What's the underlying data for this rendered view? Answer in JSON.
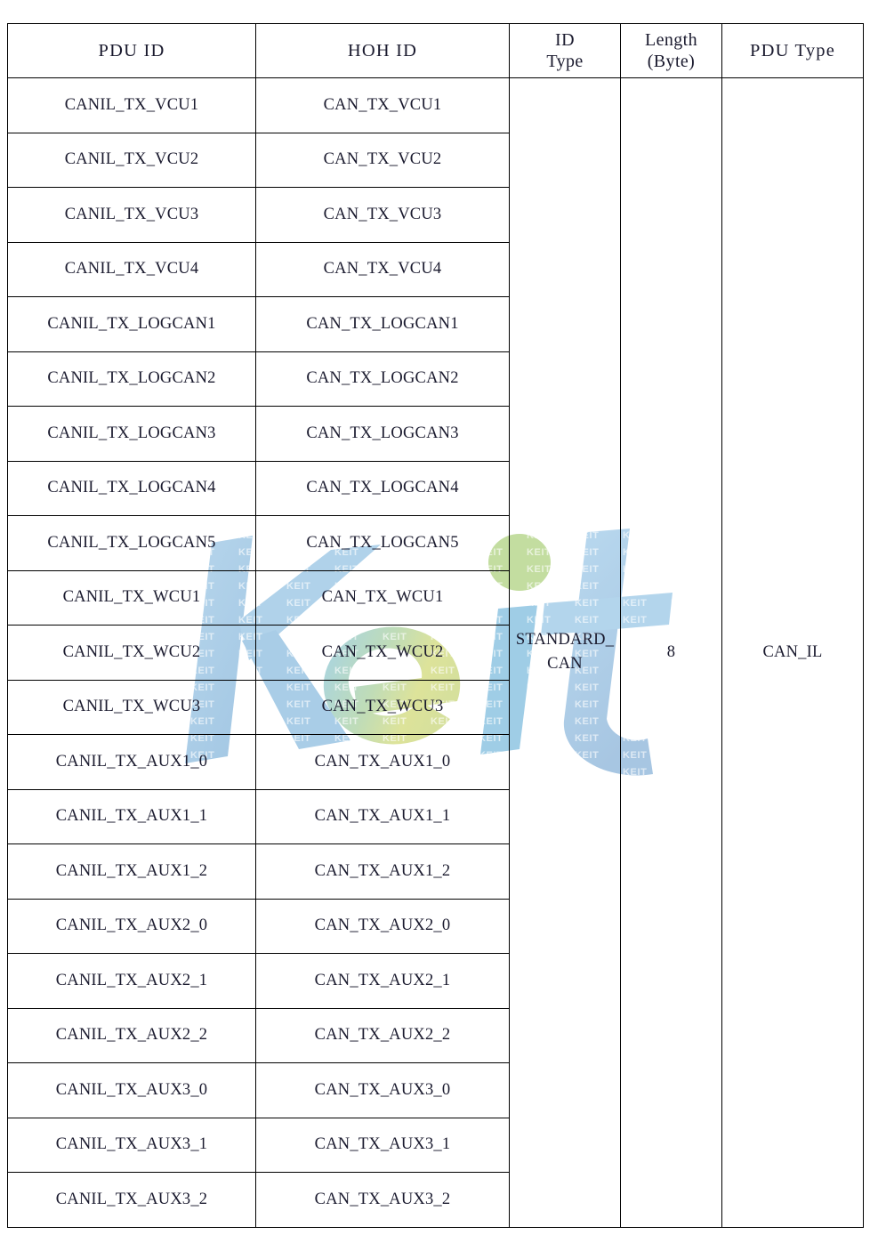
{
  "table": {
    "headers": [
      {
        "label": "PDU ID",
        "key": "pdu_id"
      },
      {
        "label": "HOH ID",
        "key": "hoh_id"
      },
      {
        "label": "ID Type",
        "key": "id_type",
        "lines": [
          "ID",
          "Type"
        ]
      },
      {
        "label": "Length (Byte)",
        "key": "length",
        "lines": [
          "Length",
          "(Byte)"
        ]
      },
      {
        "label": "PDU Type",
        "key": "pdu_type"
      }
    ],
    "merged": {
      "id_type": "STANDARD_CAN",
      "length": "8",
      "pdu_type": "CAN_IL"
    },
    "rows": [
      {
        "pdu_id": "CANIL_TX_VCU1",
        "hoh_id": "CAN_TX_VCU1"
      },
      {
        "pdu_id": "CANIL_TX_VCU2",
        "hoh_id": "CAN_TX_VCU2"
      },
      {
        "pdu_id": "CANIL_TX_VCU3",
        "hoh_id": "CAN_TX_VCU3"
      },
      {
        "pdu_id": "CANIL_TX_VCU4",
        "hoh_id": "CAN_TX_VCU4"
      },
      {
        "pdu_id": "CANIL_TX_LOGCAN1",
        "hoh_id": "CAN_TX_LOGCAN1"
      },
      {
        "pdu_id": "CANIL_TX_LOGCAN2",
        "hoh_id": "CAN_TX_LOGCAN2"
      },
      {
        "pdu_id": "CANIL_TX_LOGCAN3",
        "hoh_id": "CAN_TX_LOGCAN3"
      },
      {
        "pdu_id": "CANIL_TX_LOGCAN4",
        "hoh_id": "CAN_TX_LOGCAN4"
      },
      {
        "pdu_id": "CANIL_TX_LOGCAN5",
        "hoh_id": "CAN_TX_LOGCAN5"
      },
      {
        "pdu_id": "CANIL_TX_WCU1",
        "hoh_id": "CAN_TX_WCU1"
      },
      {
        "pdu_id": "CANIL_TX_WCU2",
        "hoh_id": "CAN_TX_WCU2"
      },
      {
        "pdu_id": "CANIL_TX_WCU3",
        "hoh_id": "CAN_TX_WCU3"
      },
      {
        "pdu_id": "CANIL_TX_AUX1_0",
        "hoh_id": "CAN_TX_AUX1_0"
      },
      {
        "pdu_id": "CANIL_TX_AUX1_1",
        "hoh_id": "CAN_TX_AUX1_1"
      },
      {
        "pdu_id": "CANIL_TX_AUX1_2",
        "hoh_id": "CAN_TX_AUX1_2"
      },
      {
        "pdu_id": "CANIL_TX_AUX2_0",
        "hoh_id": "CAN_TX_AUX2_0"
      },
      {
        "pdu_id": "CANIL_TX_AUX2_1",
        "hoh_id": "CAN_TX_AUX2_1"
      },
      {
        "pdu_id": "CANIL_TX_AUX2_2",
        "hoh_id": "CAN_TX_AUX2_2"
      },
      {
        "pdu_id": "CANIL_TX_AUX3_0",
        "hoh_id": "CAN_TX_AUX3_0"
      },
      {
        "pdu_id": "CANIL_TX_AUX3_1",
        "hoh_id": "CAN_TX_AUX3_1"
      },
      {
        "pdu_id": "CANIL_TX_AUX3_2",
        "hoh_id": "CAN_TX_AUX3_2"
      }
    ]
  },
  "watermark": {
    "text": "Keit",
    "tile_text": "KEIT",
    "colors": {
      "blue": "#a9cfe8",
      "light_blue": "#bcd9ee",
      "cyan": "#9ed4e8",
      "green_dot": "#c3dda0",
      "yellow_green": "#dde39a"
    }
  },
  "colors": {
    "border": "#000000",
    "text": "#1a1a2e",
    "page_background": "#ffffff"
  }
}
